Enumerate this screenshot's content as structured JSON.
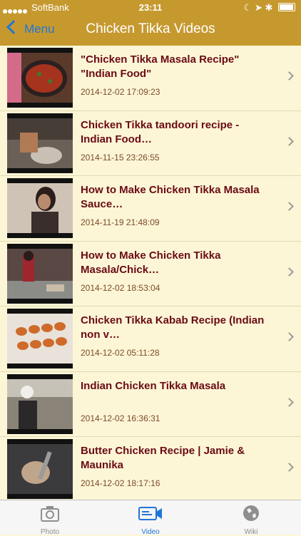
{
  "status": {
    "carrier": "SoftBank",
    "time": "23:11"
  },
  "nav": {
    "back_label": "Menu",
    "title": "Chicken Tikka Videos"
  },
  "videos": [
    {
      "title": "\"Chicken Tikka Masala Recipe\" \"Indian Food\"",
      "date": "2014-12-02 17:09:23"
    },
    {
      "title": "Chicken Tikka tandoori recipe - Indian Food…",
      "date": "2014-11-15 23:26:55"
    },
    {
      "title": "How to Make Chicken Tikka Masala Sauce…",
      "date": "2014-11-19 21:48:09"
    },
    {
      "title": "How to Make Chicken Tikka Masala/Chick…",
      "date": "2014-12-02 18:53:04"
    },
    {
      "title": "Chicken Tikka Kabab Recipe (Indian non v…",
      "date": "2014-12-02 05:11:28"
    },
    {
      "title": "Indian Chicken Tikka Masala",
      "date": "2014-12-02 16:36:31"
    },
    {
      "title": "Butter Chicken Recipe | Jamie & Maunika",
      "date": "2014-12-02 18:17:16"
    }
  ],
  "tabs": [
    {
      "label": "Photo",
      "icon": "camera-icon"
    },
    {
      "label": "Video",
      "icon": "video-camera-icon"
    },
    {
      "label": "Wiki",
      "icon": "globe-icon"
    }
  ],
  "colors": {
    "bar": "#c6992f",
    "background": "#fcf6d6",
    "accent": "#1f75d8",
    "title_text": "#6a0a15"
  }
}
